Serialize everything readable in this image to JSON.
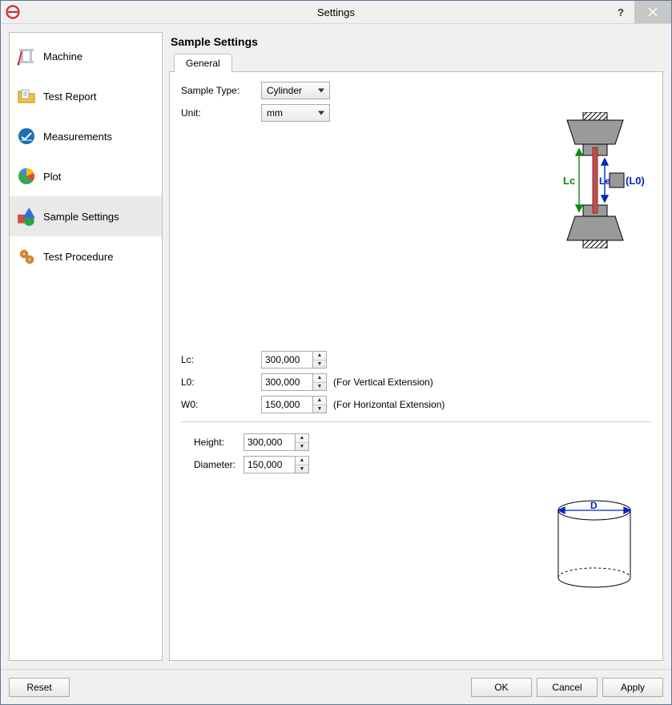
{
  "window": {
    "title": "Settings"
  },
  "sidebar": {
    "items": [
      {
        "label": "Machine"
      },
      {
        "label": "Test Report"
      },
      {
        "label": "Measurements"
      },
      {
        "label": "Plot"
      },
      {
        "label": "Sample Settings"
      },
      {
        "label": "Test Procedure"
      }
    ]
  },
  "panel": {
    "title": "Sample Settings",
    "tab_general": "General",
    "sample_type_label": "Sample Type:",
    "sample_type_value": "Cylinder",
    "unit_label": "Unit:",
    "unit_value": "mm",
    "lc_label": "Lc:",
    "lc_value": "300,000",
    "l0_label": "L0:",
    "l0_value": "300,000",
    "l0_hint": "(For Vertical Extension)",
    "w0_label": "W0:",
    "w0_value": "150,000",
    "w0_hint": "(For Horizontal Extension)",
    "height_label": "Height:",
    "height_value": "300,000",
    "diameter_label": "Diameter:",
    "diameter_value": "150,000",
    "diagram_top": {
      "Lc": "Lc",
      "Le": "Le",
      "L0": "(L0)"
    },
    "diagram_bottom": {
      "D": "D"
    }
  },
  "footer": {
    "reset": "Reset",
    "ok": "OK",
    "cancel": "Cancel",
    "apply": "Apply"
  }
}
